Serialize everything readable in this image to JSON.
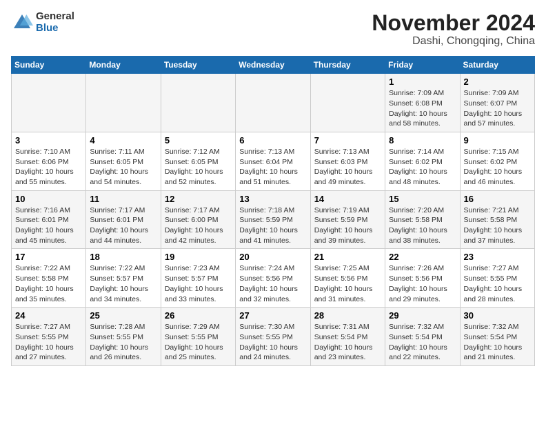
{
  "logo": {
    "general": "General",
    "blue": "Blue"
  },
  "title": "November 2024",
  "subtitle": "Dashi, Chongqing, China",
  "days_of_week": [
    "Sunday",
    "Monday",
    "Tuesday",
    "Wednesday",
    "Thursday",
    "Friday",
    "Saturday"
  ],
  "weeks": [
    [
      {
        "day": "",
        "info": ""
      },
      {
        "day": "",
        "info": ""
      },
      {
        "day": "",
        "info": ""
      },
      {
        "day": "",
        "info": ""
      },
      {
        "day": "",
        "info": ""
      },
      {
        "day": "1",
        "info": "Sunrise: 7:09 AM\nSunset: 6:08 PM\nDaylight: 10 hours and 58 minutes."
      },
      {
        "day": "2",
        "info": "Sunrise: 7:09 AM\nSunset: 6:07 PM\nDaylight: 10 hours and 57 minutes."
      }
    ],
    [
      {
        "day": "3",
        "info": "Sunrise: 7:10 AM\nSunset: 6:06 PM\nDaylight: 10 hours and 55 minutes."
      },
      {
        "day": "4",
        "info": "Sunrise: 7:11 AM\nSunset: 6:05 PM\nDaylight: 10 hours and 54 minutes."
      },
      {
        "day": "5",
        "info": "Sunrise: 7:12 AM\nSunset: 6:05 PM\nDaylight: 10 hours and 52 minutes."
      },
      {
        "day": "6",
        "info": "Sunrise: 7:13 AM\nSunset: 6:04 PM\nDaylight: 10 hours and 51 minutes."
      },
      {
        "day": "7",
        "info": "Sunrise: 7:13 AM\nSunset: 6:03 PM\nDaylight: 10 hours and 49 minutes."
      },
      {
        "day": "8",
        "info": "Sunrise: 7:14 AM\nSunset: 6:02 PM\nDaylight: 10 hours and 48 minutes."
      },
      {
        "day": "9",
        "info": "Sunrise: 7:15 AM\nSunset: 6:02 PM\nDaylight: 10 hours and 46 minutes."
      }
    ],
    [
      {
        "day": "10",
        "info": "Sunrise: 7:16 AM\nSunset: 6:01 PM\nDaylight: 10 hours and 45 minutes."
      },
      {
        "day": "11",
        "info": "Sunrise: 7:17 AM\nSunset: 6:01 PM\nDaylight: 10 hours and 44 minutes."
      },
      {
        "day": "12",
        "info": "Sunrise: 7:17 AM\nSunset: 6:00 PM\nDaylight: 10 hours and 42 minutes."
      },
      {
        "day": "13",
        "info": "Sunrise: 7:18 AM\nSunset: 5:59 PM\nDaylight: 10 hours and 41 minutes."
      },
      {
        "day": "14",
        "info": "Sunrise: 7:19 AM\nSunset: 5:59 PM\nDaylight: 10 hours and 39 minutes."
      },
      {
        "day": "15",
        "info": "Sunrise: 7:20 AM\nSunset: 5:58 PM\nDaylight: 10 hours and 38 minutes."
      },
      {
        "day": "16",
        "info": "Sunrise: 7:21 AM\nSunset: 5:58 PM\nDaylight: 10 hours and 37 minutes."
      }
    ],
    [
      {
        "day": "17",
        "info": "Sunrise: 7:22 AM\nSunset: 5:58 PM\nDaylight: 10 hours and 35 minutes."
      },
      {
        "day": "18",
        "info": "Sunrise: 7:22 AM\nSunset: 5:57 PM\nDaylight: 10 hours and 34 minutes."
      },
      {
        "day": "19",
        "info": "Sunrise: 7:23 AM\nSunset: 5:57 PM\nDaylight: 10 hours and 33 minutes."
      },
      {
        "day": "20",
        "info": "Sunrise: 7:24 AM\nSunset: 5:56 PM\nDaylight: 10 hours and 32 minutes."
      },
      {
        "day": "21",
        "info": "Sunrise: 7:25 AM\nSunset: 5:56 PM\nDaylight: 10 hours and 31 minutes."
      },
      {
        "day": "22",
        "info": "Sunrise: 7:26 AM\nSunset: 5:56 PM\nDaylight: 10 hours and 29 minutes."
      },
      {
        "day": "23",
        "info": "Sunrise: 7:27 AM\nSunset: 5:55 PM\nDaylight: 10 hours and 28 minutes."
      }
    ],
    [
      {
        "day": "24",
        "info": "Sunrise: 7:27 AM\nSunset: 5:55 PM\nDaylight: 10 hours and 27 minutes."
      },
      {
        "day": "25",
        "info": "Sunrise: 7:28 AM\nSunset: 5:55 PM\nDaylight: 10 hours and 26 minutes."
      },
      {
        "day": "26",
        "info": "Sunrise: 7:29 AM\nSunset: 5:55 PM\nDaylight: 10 hours and 25 minutes."
      },
      {
        "day": "27",
        "info": "Sunrise: 7:30 AM\nSunset: 5:55 PM\nDaylight: 10 hours and 24 minutes."
      },
      {
        "day": "28",
        "info": "Sunrise: 7:31 AM\nSunset: 5:54 PM\nDaylight: 10 hours and 23 minutes."
      },
      {
        "day": "29",
        "info": "Sunrise: 7:32 AM\nSunset: 5:54 PM\nDaylight: 10 hours and 22 minutes."
      },
      {
        "day": "30",
        "info": "Sunrise: 7:32 AM\nSunset: 5:54 PM\nDaylight: 10 hours and 21 minutes."
      }
    ]
  ]
}
